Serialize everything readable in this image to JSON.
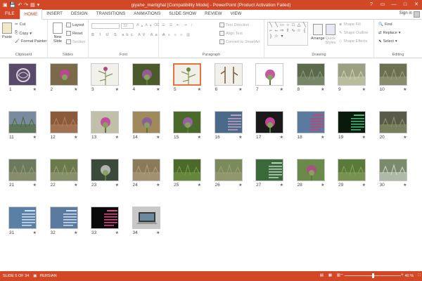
{
  "titlebar": {
    "title": "giyahe_martighal [Compatibility Mode] - PowerPoint (Product Activation Failed)",
    "qat": [
      "save-icon",
      "undo-icon",
      "redo-icon",
      "start-icon"
    ],
    "controls": [
      "?",
      "▭",
      "—",
      "□",
      "✕"
    ]
  },
  "tabs": {
    "file": "FILE",
    "items": [
      "HOME",
      "INSERT",
      "DESIGN",
      "TRANSITIONS",
      "ANIMATIONS",
      "SLIDE SHOW",
      "REVIEW",
      "VIEW"
    ],
    "active": "HOME",
    "signin": "Sign in"
  },
  "ribbon": {
    "clipboard": {
      "paste": "Paste",
      "cut": "Cut",
      "copy": "Copy",
      "format_painter": "Format Painter",
      "label": "Clipboard"
    },
    "slides": {
      "new_slide": "New Slide",
      "layout": "Layout",
      "reset": "Reset",
      "section": "Section",
      "label": "Slides"
    },
    "font": {
      "size": "32",
      "label": "Font"
    },
    "paragraph": {
      "text_direction": "Text Direction",
      "align_text": "Align Text",
      "convert": "Convert to SmartArt",
      "label": "Paragraph"
    },
    "drawing": {
      "arrange": "Arrange",
      "quick_styles": "Quick Styles",
      "shape_fill": "Shape Fill",
      "shape_outline": "Shape Outline",
      "shape_effects": "Shape Effects",
      "label": "Drawing"
    },
    "editing": {
      "find": "Find",
      "replace": "Replace",
      "select": "Select",
      "label": "Editing"
    }
  },
  "slides": [
    {
      "num": "1",
      "bg": "#5a4a6a",
      "fg": "#d8d0d8",
      "kind": "logo"
    },
    {
      "num": "2",
      "bg": "#7a6a4a",
      "fg": "#c0449a",
      "kind": "flower"
    },
    {
      "num": "3",
      "bg": "#f2f0ea",
      "fg": "#b04a7a",
      "kind": "drawing"
    },
    {
      "num": "4",
      "bg": "#4a5a2a",
      "fg": "#a05aa0",
      "kind": "flower"
    },
    {
      "num": "5",
      "bg": "#f0efe8",
      "fg": "#6a8a3a",
      "kind": "drawing"
    },
    {
      "num": "6",
      "bg": "#f2f0ea",
      "fg": "#7a5a3a",
      "kind": "root"
    },
    {
      "num": "7",
      "bg": "#ffffff",
      "fg": "#c0449a",
      "kind": "flower"
    },
    {
      "num": "8",
      "bg": "#5a6a4a",
      "fg": "#8a9a7a",
      "kind": "field"
    },
    {
      "num": "9",
      "bg": "#9aa080",
      "fg": "#d0d0b0",
      "kind": "field"
    },
    {
      "num": "10",
      "bg": "#6a7050",
      "fg": "#a0a080",
      "kind": "field"
    },
    {
      "num": "11",
      "bg": "#7a8aa0",
      "fg": "#4a6a2a",
      "kind": "field"
    },
    {
      "num": "12",
      "bg": "#8a5a3a",
      "fg": "#b08060",
      "kind": "field"
    },
    {
      "num": "13",
      "bg": "#c0c0a8",
      "fg": "#c0449a",
      "kind": "flower"
    },
    {
      "num": "14",
      "bg": "#a08a5a",
      "fg": "#8a5aa0",
      "kind": "flower"
    },
    {
      "num": "15",
      "bg": "#4a6a2a",
      "fg": "#a060b0",
      "kind": "flower"
    },
    {
      "num": "16",
      "bg": "#4a6a8a",
      "fg": "#c0a0c0",
      "kind": "text"
    },
    {
      "num": "17",
      "bg": "#1a1a1a",
      "fg": "#d04aa0",
      "kind": "flower"
    },
    {
      "num": "18",
      "bg": "#5a7aa0",
      "fg": "#d0406a",
      "kind": "text"
    },
    {
      "num": "19",
      "bg": "#0a1a0a",
      "fg": "#40c080",
      "kind": "text"
    },
    {
      "num": "20",
      "bg": "#5a5a4a",
      "fg": "#8a9a6a",
      "kind": "field"
    },
    {
      "num": "21",
      "bg": "#6a7a5a",
      "fg": "#9a9a7a",
      "kind": "field"
    },
    {
      "num": "22",
      "bg": "#6a7a4a",
      "fg": "#9aa080",
      "kind": "field"
    },
    {
      "num": "23",
      "bg": "#3a4a3a",
      "fg": "#c0c0c0",
      "kind": "flower"
    },
    {
      "num": "24",
      "bg": "#8a7a5a",
      "fg": "#b0a080",
      "kind": "field"
    },
    {
      "num": "25",
      "bg": "#4a6a2a",
      "fg": "#7a9a4a",
      "kind": "field"
    },
    {
      "num": "26",
      "bg": "#7a8a5a",
      "fg": "#a0a07a",
      "kind": "field"
    },
    {
      "num": "27",
      "bg": "#3a6a3a",
      "fg": "#c0d0c0",
      "kind": "text"
    },
    {
      "num": "28",
      "bg": "#6a8a4a",
      "fg": "#b04a8a",
      "kind": "flower"
    },
    {
      "num": "29",
      "bg": "#5a7a3a",
      "fg": "#8aa060",
      "kind": "field"
    },
    {
      "num": "30",
      "bg": "#7a8a6a",
      "fg": "#d0d8d0",
      "kind": "field"
    },
    {
      "num": "31",
      "bg": "#5a80a8",
      "fg": "#d0e0f0",
      "kind": "text"
    },
    {
      "num": "32",
      "bg": "#5a7aa0",
      "fg": "#d0e0f0",
      "kind": "text"
    },
    {
      "num": "33",
      "bg": "#0a0a0a",
      "fg": "#e04a8a",
      "kind": "text"
    },
    {
      "num": "34",
      "bg": "#c8c8c8",
      "fg": "#3a3a3a",
      "kind": "laptop"
    }
  ],
  "selected_slide": "5",
  "star": "★",
  "status": {
    "slide": "SLIDE 5 OF 34",
    "lang": "PERSIAN",
    "zoom": "40 %",
    "zoom_minus": "−",
    "zoom_plus": "+"
  },
  "colors": {
    "accent": "#d24726",
    "selection": "#e8743b"
  }
}
